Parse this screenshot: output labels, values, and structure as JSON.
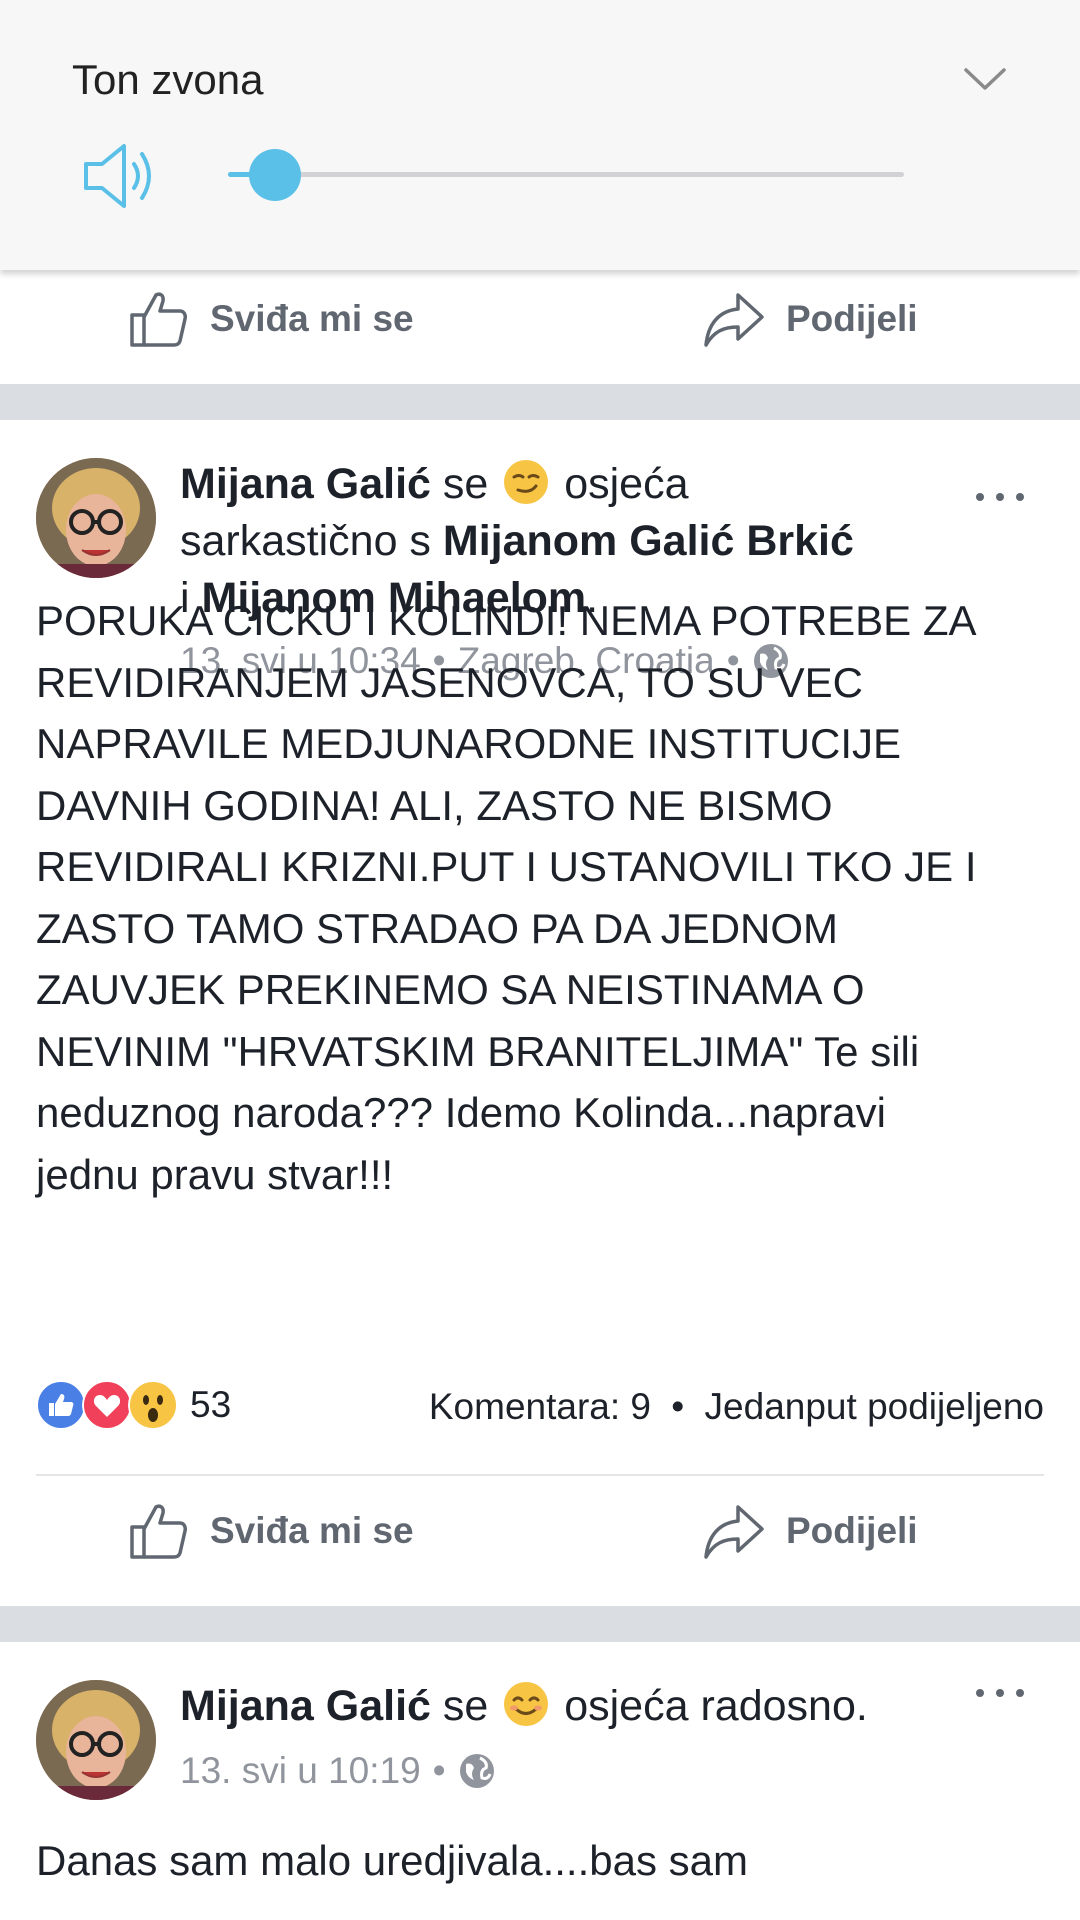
{
  "volume": {
    "title": "Ton zvona",
    "level_fraction": 0.07,
    "icon": "speaker-icon",
    "accent_color": "#5bc0e8"
  },
  "actions": {
    "like_label": "Sviđa mi se",
    "share_label": "Podijeli"
  },
  "posts": [
    {
      "author": "Mijana Galić",
      "feeling_prefix": "se",
      "feeling_emoji": "smirk-emoji",
      "feeling_text": "osjeća",
      "feeling_word": "sarkastično s",
      "tag1": "Mijanom Galić Brkić",
      "conj": "i",
      "tag2": "Mijanom Mihaelom",
      "period": ".",
      "time": "13. svi u 10:34",
      "location": "Zagreb, Croatia",
      "dot": "•",
      "body_lines": [
        "PORUKA CICKU I KOLINDI! NEMA POTREBE ZA",
        "REVIDIRANJEM JASENOVCA, TO SU VEC",
        "NAPRAVILE MEDJUNARODNE INSTITUCIJE",
        "DAVNIH GODINA! ALI, ZASTO NE BISMO",
        "REVIDIRALI KRIZNI.PUT I USTANOVILI TKO JE I",
        "ZASTO TAMO STRADAO PA DA JEDNOM",
        "ZAUVJEK PREKINEMO SA NEISTINAMA O",
        "NEVINIM \"HRVATSKIM BRANITELJIMA\" Te sili",
        "neduznog naroda??? Idemo Kolinda...napravi",
        "jednu pravu stvar!!!"
      ],
      "reaction_count": "53",
      "comments": "Komentara: 9",
      "shares": "Jedanput podijeljeno"
    },
    {
      "author": "Mijana Galić",
      "feeling_prefix": "se",
      "feeling_emoji": "smile-emoji",
      "feeling_text": "osjeća radosno.",
      "time": "13. svi u 10:19",
      "dot": "•",
      "body_lines": [
        "Danas sam malo uredjivala....bas sam"
      ]
    }
  ]
}
